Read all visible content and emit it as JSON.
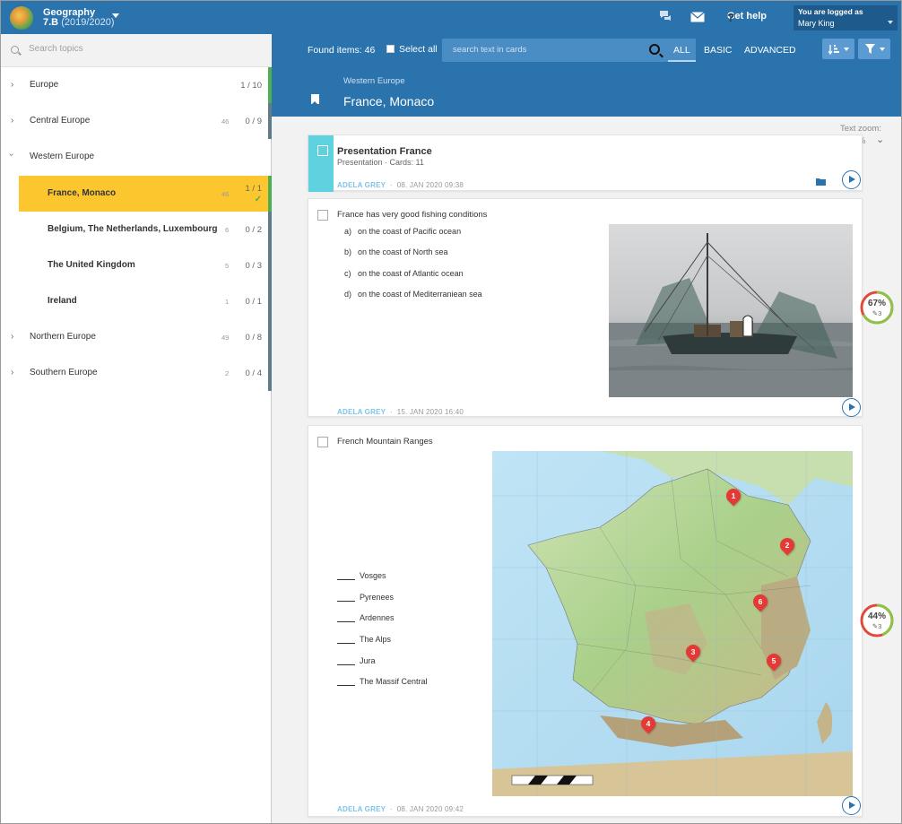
{
  "header": {
    "app_name": "Geography",
    "class": "7.B",
    "year": "(2019/2020)",
    "help": "Get help",
    "login_label": "You are logged as",
    "user": "Mary King"
  },
  "sidebar": {
    "search_placeholder": "Search topics",
    "topics": [
      {
        "name": "Europe",
        "count": "",
        "progress": "1 / 10",
        "bar": "#4caf50"
      },
      {
        "name": "Central Europe",
        "count": "46",
        "progress": "0 / 9",
        "bar": "#5f7c8a"
      },
      {
        "name": "Western Europe",
        "count": "",
        "progress": "",
        "bar": ""
      },
      {
        "name": "France, Monaco",
        "count": "46",
        "progress": "1 / 1",
        "bar": "#4caf50"
      },
      {
        "name": "Belgium, The Netherlands, Luxembourg",
        "count": "6",
        "progress": "0 / 2",
        "bar": "#5f7c8a"
      },
      {
        "name": "The United Kingdom",
        "count": "5",
        "progress": "0 / 3",
        "bar": "#5f7c8a"
      },
      {
        "name": "Ireland",
        "count": "1",
        "progress": "0 / 1",
        "bar": "#5f7c8a"
      },
      {
        "name": "Northern Europe",
        "count": "49",
        "progress": "0 / 8",
        "bar": "#5f7c8a"
      },
      {
        "name": "Southern Europe",
        "count": "2",
        "progress": "0 / 4",
        "bar": "#5f7c8a"
      }
    ]
  },
  "toolbar": {
    "found": "Found items: 46",
    "select_all": "Select all",
    "search_placeholder": "search text in cards",
    "filters": [
      "ALL",
      "BASIC",
      "ADVANCED"
    ]
  },
  "page": {
    "breadcrumb": "Western Europe",
    "title": "France, Monaco",
    "text_zoom_label": "Text zoom:",
    "text_zoom_value": "%"
  },
  "cards": {
    "presentation": {
      "title": "Presentation France",
      "meta": "Presentation · Cards: 11",
      "author": "ADELA GREY",
      "date": "08. JAN 2020 09:38"
    },
    "fishing": {
      "question": "France has very good fishing conditions",
      "options": [
        {
          "letter": "a)",
          "text": "on the coast of Pacific ocean"
        },
        {
          "letter": "b)",
          "text": "on the coast of North sea"
        },
        {
          "letter": "c)",
          "text": "on the coast of Atlantic ocean"
        },
        {
          "letter": "d)",
          "text": "on the coast of Mediterraniean sea"
        }
      ],
      "author": "ADELA GREY",
      "date": "15. JAN 2020 16:40",
      "score": "67%",
      "score_count": "3",
      "score_fraction": 0.67
    },
    "mountains": {
      "question": "French Mountain Ranges",
      "labels": [
        "Vosges",
        "Pyrenees",
        "Ardennes",
        "The Alps",
        "Jura",
        "The Massif Central"
      ],
      "pins": [
        "1",
        "2",
        "3",
        "4",
        "5",
        "6"
      ],
      "author": "ADELA GREY",
      "date": "08. JAN 2020 09:42",
      "score": "44%",
      "score_count": "3",
      "score_fraction": 0.44
    }
  },
  "colors": {
    "primary": "#2b73ad",
    "active_topic": "#fcc72e",
    "done": "#4caf50",
    "author": "#7cc4e8"
  }
}
